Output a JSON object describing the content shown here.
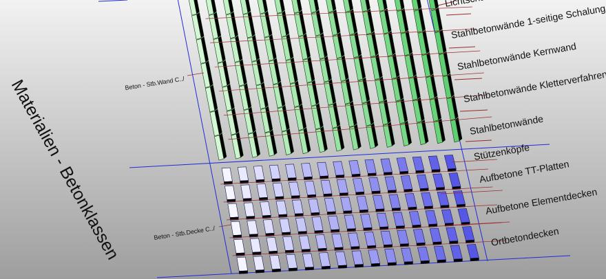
{
  "viewport": {
    "background_top": "#f2f2f2",
    "background_bottom": "#9e9e9e",
    "frame_line_color": "#1e2bd6",
    "section_line_color": "#9a2a2a"
  },
  "title": "Materialien - Betonklassen",
  "sections": {
    "wall": {
      "label": "Beton - Stb.Wand C../",
      "panel_color_light": "#d6f7d6",
      "panel_color_dark": "#5fcf72",
      "panel_edge_color": "#0c3a10",
      "columns": 15,
      "rows": 7
    },
    "slab": {
      "label": "Beton - Stb.Decke C../",
      "block_color_light": "#f4f5ff",
      "block_color_dark": "#5757e6",
      "block_edge_color": "#1a1a4a",
      "columns": 15,
      "rows": 6
    }
  },
  "labels": [
    "Lichtschächte",
    "Stahlbetonwände 1-seitige Schalung",
    "Stahlbetonwände Kernwand",
    "Stahlbetonwände Kletterverfahren",
    "Stahlbetonwände",
    "Stützenköpfe",
    "Aufbetone TT-Platten",
    "Aufbetone Elementdecken",
    "Ortbetondecken"
  ]
}
